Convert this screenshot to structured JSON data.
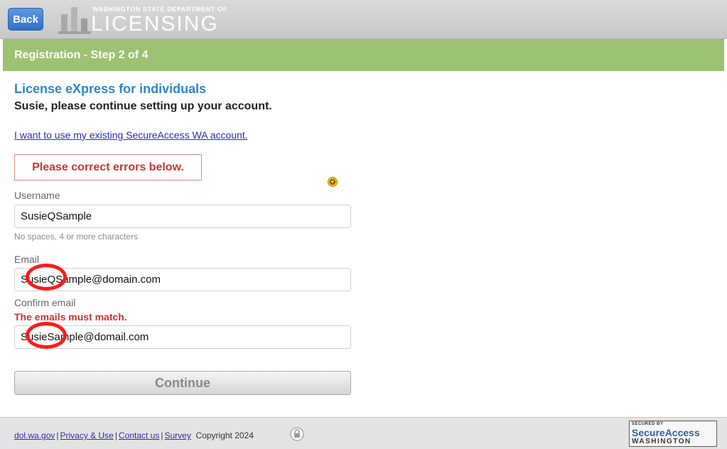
{
  "header": {
    "back_label": "Back",
    "logo_top": "WASHINGTON STATE DEPARTMENT OF",
    "logo_main": "LICENSING"
  },
  "step_bar": {
    "title": "Registration - Step 2 of 4"
  },
  "main": {
    "title": "License eXpress for individuals",
    "subtitle": "Susie, please continue setting up your account.",
    "secureaccess_link": "I want to use my existing SecureAccess WA account.",
    "error_banner": "Please correct errors below.",
    "username": {
      "label": "Username",
      "value": "SusieQSample",
      "hint": "No spaces, 4 or more characters"
    },
    "email": {
      "label": "Email",
      "value": "SusieQSample@domain.com"
    },
    "confirm_email": {
      "label": "Confirm email",
      "error": "The emails must match.",
      "value": "SusieSample@domail.com"
    },
    "continue_label": "Continue"
  },
  "footer": {
    "link_dol": "dol.wa.gov",
    "link_privacy": "Privacy & Use",
    "link_contact": "Contact us",
    "link_survey": "Survey",
    "copyright": "Copyright 2024",
    "badge_secured": "SECURED BY",
    "badge_name": "SecureAccess",
    "badge_state": "WASHINGTON"
  },
  "colors": {
    "step_bar": "#9cc173",
    "title_blue": "#2f86c8",
    "error_red": "#cc3333",
    "annotation_red": "#ff1a1a",
    "back_button": "#2f70c6"
  }
}
